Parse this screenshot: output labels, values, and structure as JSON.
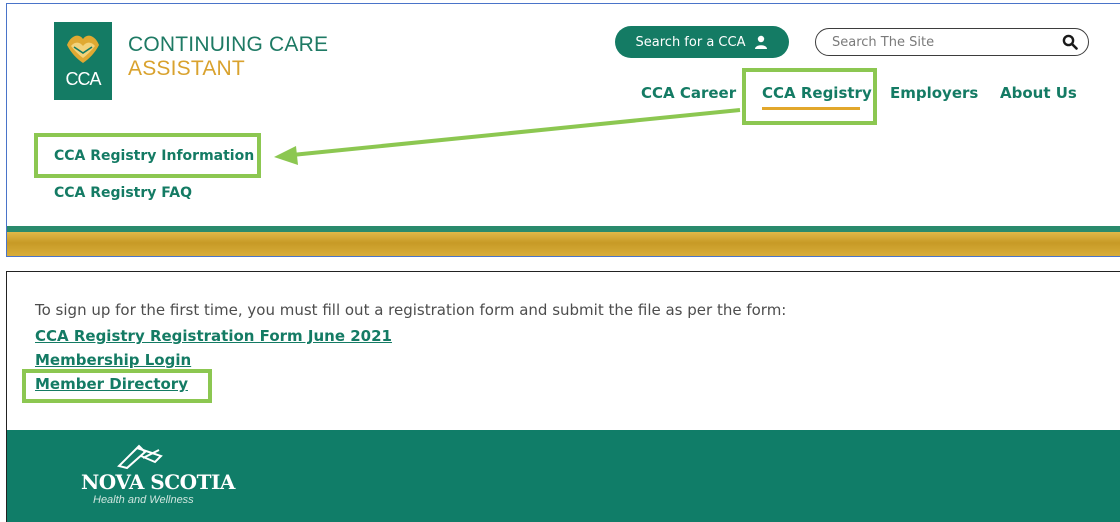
{
  "brand": {
    "logo_text": "CCA",
    "name_line1": "CONTINUING CARE",
    "name_line2": "ASSISTANT"
  },
  "header": {
    "search_cca_label": "Search for a CCA",
    "search_placeholder": "Search The Site"
  },
  "nav": [
    {
      "label": "CCA Career"
    },
    {
      "label": "CCA Registry",
      "active": true
    },
    {
      "label": "Employers"
    },
    {
      "label": "About Us"
    }
  ],
  "submenu": [
    {
      "label": "CCA Registry Information",
      "highlighted": true
    },
    {
      "label": "CCA Registry FAQ"
    }
  ],
  "content": {
    "intro": "To sign up for the first time, you must fill out a registration form and submit the file as per the form:",
    "links": [
      {
        "label": "CCA Registry Registration Form June 2021"
      },
      {
        "label": "Membership Login"
      },
      {
        "label": "Member Directory",
        "highlighted": true
      }
    ]
  },
  "footer": {
    "org_name": "NOVA SCOTIA",
    "org_sub": "Health and Wellness"
  },
  "colors": {
    "brand_green": "#147b64",
    "brand_gold": "#d9a22e",
    "highlight": "#8cc751",
    "footer_bg": "#107d68"
  },
  "icons": [
    "hands-logo-icon",
    "user-icon",
    "search-icon",
    "nova-scotia-flag-icon",
    "annotation-arrow"
  ]
}
